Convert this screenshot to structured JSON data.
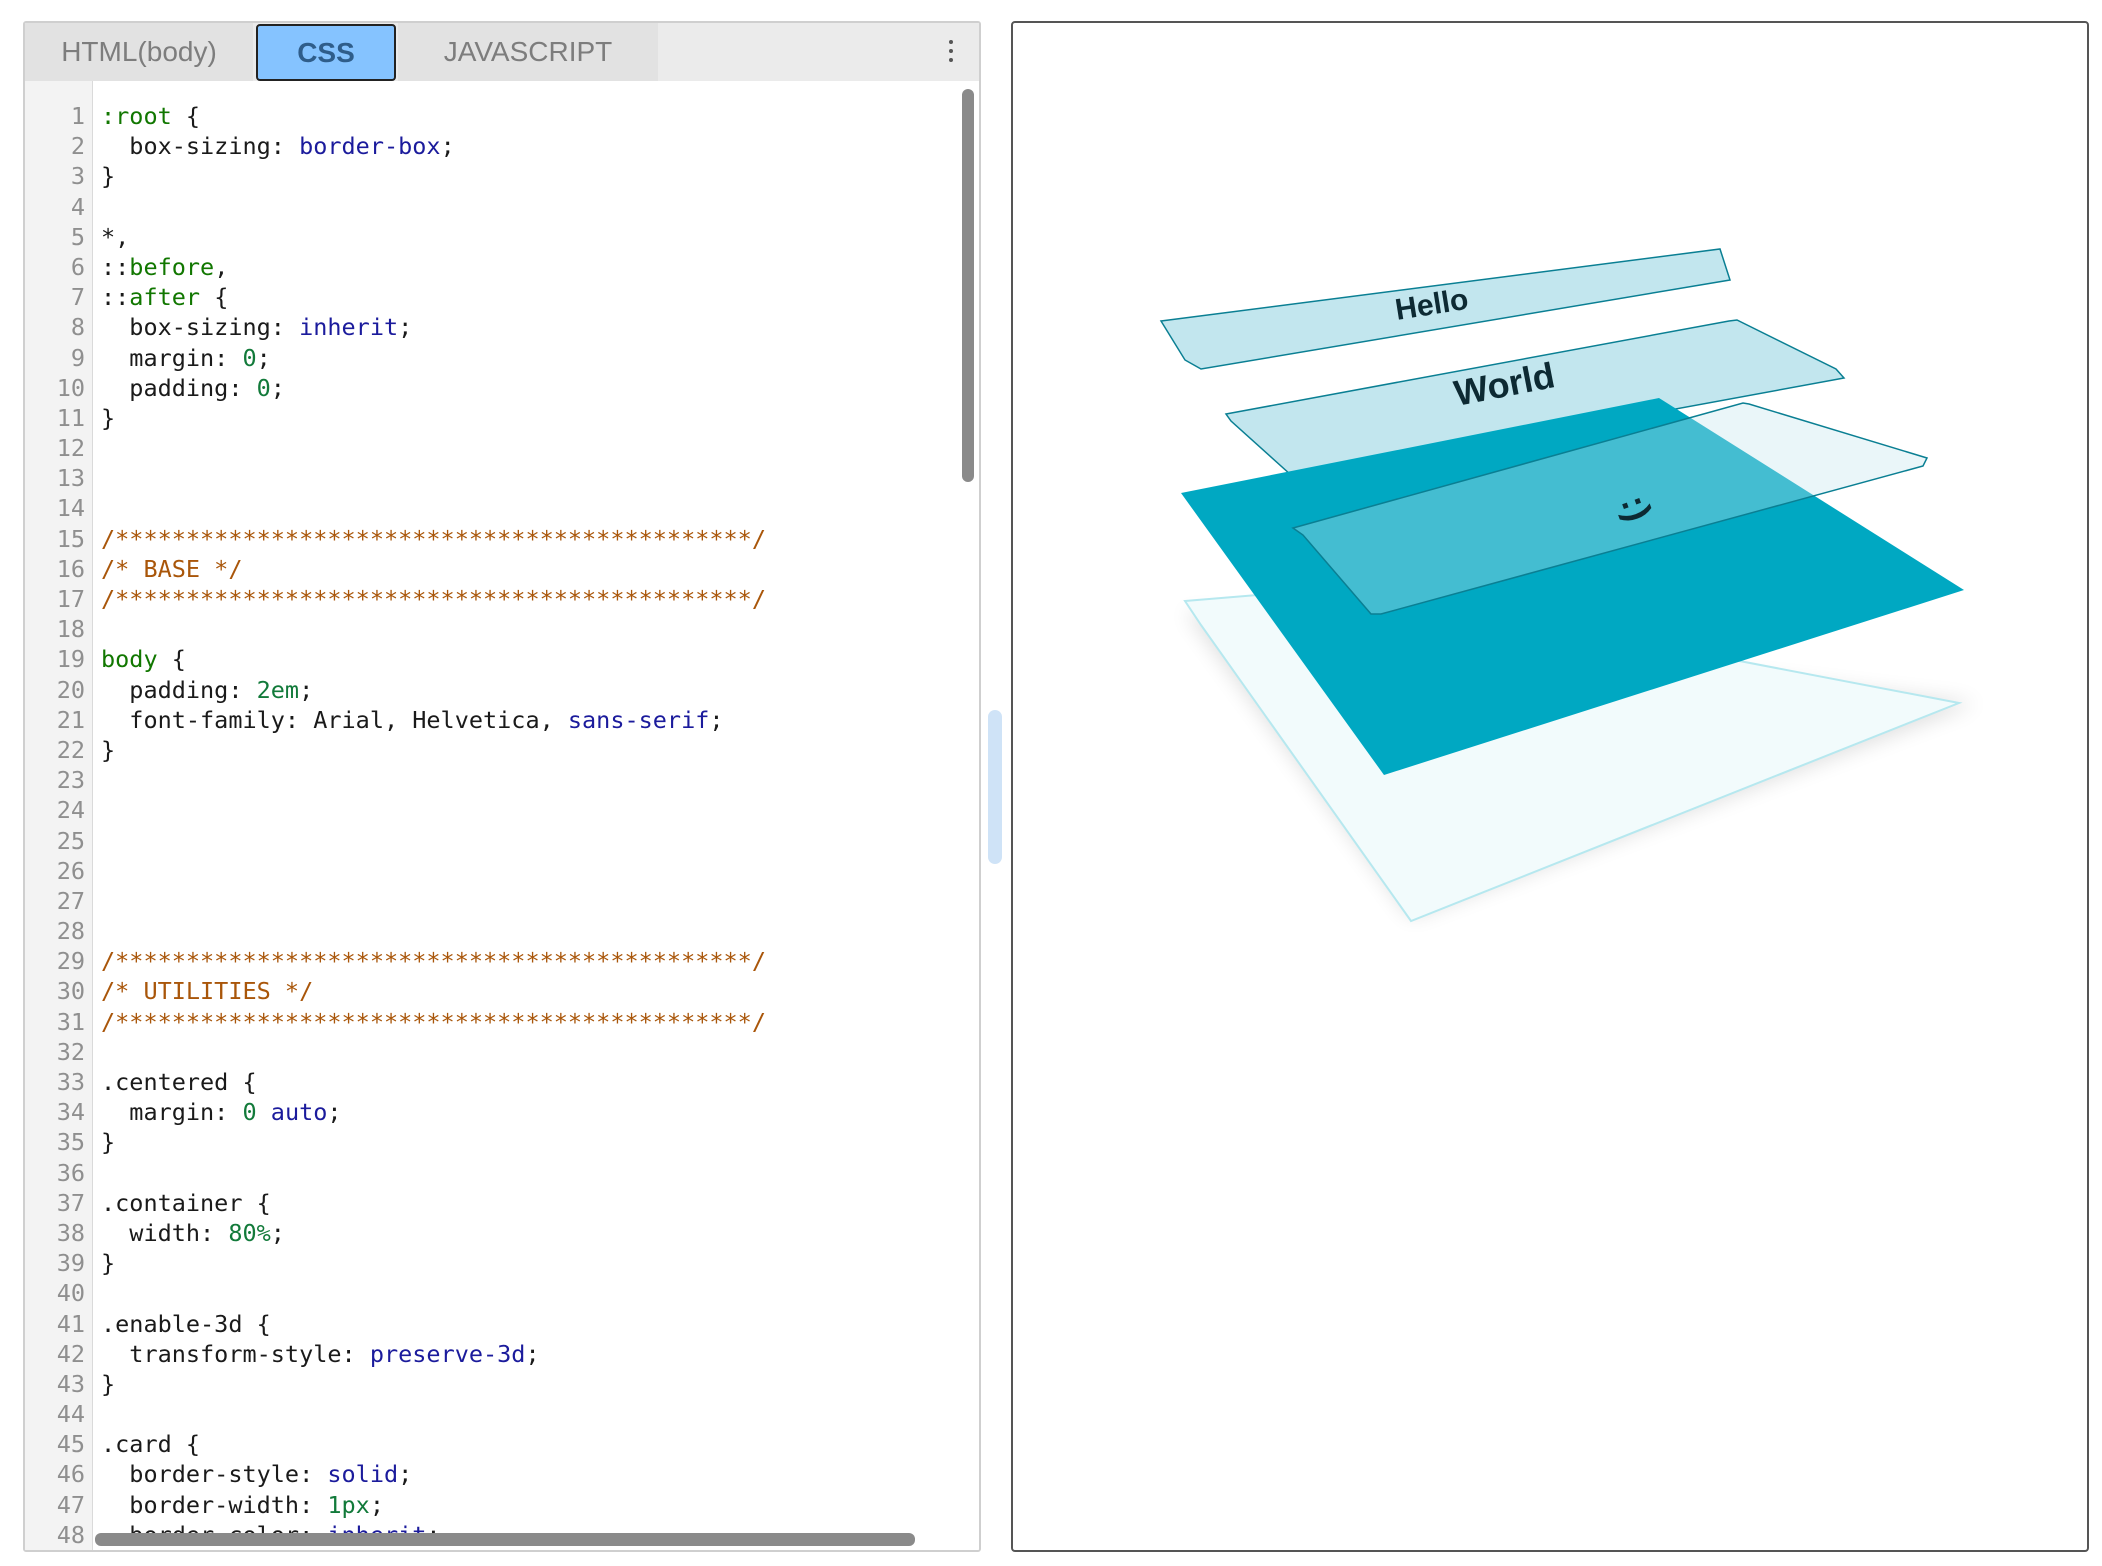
{
  "tabs": [
    {
      "id": "html",
      "label": "HTML(body)"
    },
    {
      "id": "css",
      "label": "CSS",
      "active": true
    },
    {
      "id": "js",
      "label": "JAVASCRIPT"
    }
  ],
  "editor": {
    "lines": [
      {
        "n": "1",
        "parts": [
          {
            "t": ":root",
            "c": "sel"
          },
          {
            "t": " {",
            "c": ""
          }
        ]
      },
      {
        "n": "2",
        "parts": [
          {
            "t": "  box-sizing: ",
            "c": ""
          },
          {
            "t": "border-box",
            "c": "kw"
          },
          {
            "t": ";",
            "c": ""
          }
        ]
      },
      {
        "n": "3",
        "parts": [
          {
            "t": "}",
            "c": ""
          }
        ]
      },
      {
        "n": "4",
        "parts": []
      },
      {
        "n": "5",
        "parts": [
          {
            "t": "*,",
            "c": ""
          }
        ]
      },
      {
        "n": "6",
        "parts": [
          {
            "t": "::",
            "c": ""
          },
          {
            "t": "before",
            "c": "sel"
          },
          {
            "t": ",",
            "c": ""
          }
        ]
      },
      {
        "n": "7",
        "parts": [
          {
            "t": "::",
            "c": ""
          },
          {
            "t": "after",
            "c": "sel"
          },
          {
            "t": " {",
            "c": ""
          }
        ]
      },
      {
        "n": "8",
        "parts": [
          {
            "t": "  box-sizing: ",
            "c": ""
          },
          {
            "t": "inherit",
            "c": "kw"
          },
          {
            "t": ";",
            "c": ""
          }
        ]
      },
      {
        "n": "9",
        "parts": [
          {
            "t": "  margin: ",
            "c": ""
          },
          {
            "t": "0",
            "c": "num"
          },
          {
            "t": ";",
            "c": ""
          }
        ]
      },
      {
        "n": "10",
        "parts": [
          {
            "t": "  padding: ",
            "c": ""
          },
          {
            "t": "0",
            "c": "num"
          },
          {
            "t": ";",
            "c": ""
          }
        ]
      },
      {
        "n": "11",
        "parts": [
          {
            "t": "}",
            "c": ""
          }
        ]
      },
      {
        "n": "12",
        "parts": []
      },
      {
        "n": "13",
        "parts": []
      },
      {
        "n": "14",
        "parts": []
      },
      {
        "n": "15",
        "parts": [
          {
            "t": "/*********************************************/",
            "c": "com"
          }
        ]
      },
      {
        "n": "16",
        "parts": [
          {
            "t": "/* BASE */",
            "c": "com"
          }
        ]
      },
      {
        "n": "17",
        "parts": [
          {
            "t": "/*********************************************/",
            "c": "com"
          }
        ]
      },
      {
        "n": "18",
        "parts": []
      },
      {
        "n": "19",
        "parts": [
          {
            "t": "body",
            "c": "tag"
          },
          {
            "t": " {",
            "c": ""
          }
        ]
      },
      {
        "n": "20",
        "parts": [
          {
            "t": "  padding: ",
            "c": ""
          },
          {
            "t": "2em",
            "c": "num"
          },
          {
            "t": ";",
            "c": ""
          }
        ]
      },
      {
        "n": "21",
        "parts": [
          {
            "t": "  font-family: Arial, Helvetica, ",
            "c": ""
          },
          {
            "t": "sans-serif",
            "c": "kw"
          },
          {
            "t": ";",
            "c": ""
          }
        ]
      },
      {
        "n": "22",
        "parts": [
          {
            "t": "}",
            "c": ""
          }
        ]
      },
      {
        "n": "23",
        "parts": []
      },
      {
        "n": "24",
        "parts": []
      },
      {
        "n": "25",
        "parts": []
      },
      {
        "n": "26",
        "parts": []
      },
      {
        "n": "27",
        "parts": []
      },
      {
        "n": "28",
        "parts": []
      },
      {
        "n": "29",
        "parts": [
          {
            "t": "/*********************************************/",
            "c": "com"
          }
        ]
      },
      {
        "n": "30",
        "parts": [
          {
            "t": "/* UTILITIES */",
            "c": "com"
          }
        ]
      },
      {
        "n": "31",
        "parts": [
          {
            "t": "/*********************************************/",
            "c": "com"
          }
        ]
      },
      {
        "n": "32",
        "parts": []
      },
      {
        "n": "33",
        "parts": [
          {
            "t": ".centered {",
            "c": ""
          }
        ]
      },
      {
        "n": "34",
        "parts": [
          {
            "t": "  margin: ",
            "c": ""
          },
          {
            "t": "0",
            "c": "num"
          },
          {
            "t": " ",
            "c": ""
          },
          {
            "t": "auto",
            "c": "kw"
          },
          {
            "t": ";",
            "c": ""
          }
        ]
      },
      {
        "n": "35",
        "parts": [
          {
            "t": "}",
            "c": ""
          }
        ]
      },
      {
        "n": "36",
        "parts": []
      },
      {
        "n": "37",
        "parts": [
          {
            "t": ".container {",
            "c": ""
          }
        ]
      },
      {
        "n": "38",
        "parts": [
          {
            "t": "  width: ",
            "c": ""
          },
          {
            "t": "80%",
            "c": "num"
          },
          {
            "t": ";",
            "c": ""
          }
        ]
      },
      {
        "n": "39",
        "parts": [
          {
            "t": "}",
            "c": ""
          }
        ]
      },
      {
        "n": "40",
        "parts": []
      },
      {
        "n": "41",
        "parts": [
          {
            "t": ".enable-3d {",
            "c": ""
          }
        ]
      },
      {
        "n": "42",
        "parts": [
          {
            "t": "  transform-style: ",
            "c": ""
          },
          {
            "t": "preserve-3d",
            "c": "kw"
          },
          {
            "t": ";",
            "c": ""
          }
        ]
      },
      {
        "n": "43",
        "parts": [
          {
            "t": "}",
            "c": ""
          }
        ]
      },
      {
        "n": "44",
        "parts": []
      },
      {
        "n": "45",
        "parts": [
          {
            "t": ".card {",
            "c": ""
          }
        ]
      },
      {
        "n": "46",
        "parts": [
          {
            "t": "  border-style: ",
            "c": ""
          },
          {
            "t": "solid",
            "c": "kw"
          },
          {
            "t": ";",
            "c": ""
          }
        ]
      },
      {
        "n": "47",
        "parts": [
          {
            "t": "  border-width: ",
            "c": ""
          },
          {
            "t": "1px",
            "c": "num"
          },
          {
            "t": ";",
            "c": ""
          }
        ]
      },
      {
        "n": "48",
        "parts": [
          {
            "t": "  border-color: ",
            "c": ""
          },
          {
            "t": "inherit",
            "c": "kw"
          },
          {
            "t": ";",
            "c": ""
          }
        ]
      }
    ]
  },
  "preview": {
    "cards": [
      {
        "label": "Hello"
      },
      {
        "label": "World"
      },
      {
        "label": ":)"
      }
    ],
    "colors": {
      "accent": "#00a8c2",
      "card_fill": "#c2e6ee",
      "card_stroke": "#0a7f93",
      "base_fill": "#f2fbfc"
    }
  }
}
